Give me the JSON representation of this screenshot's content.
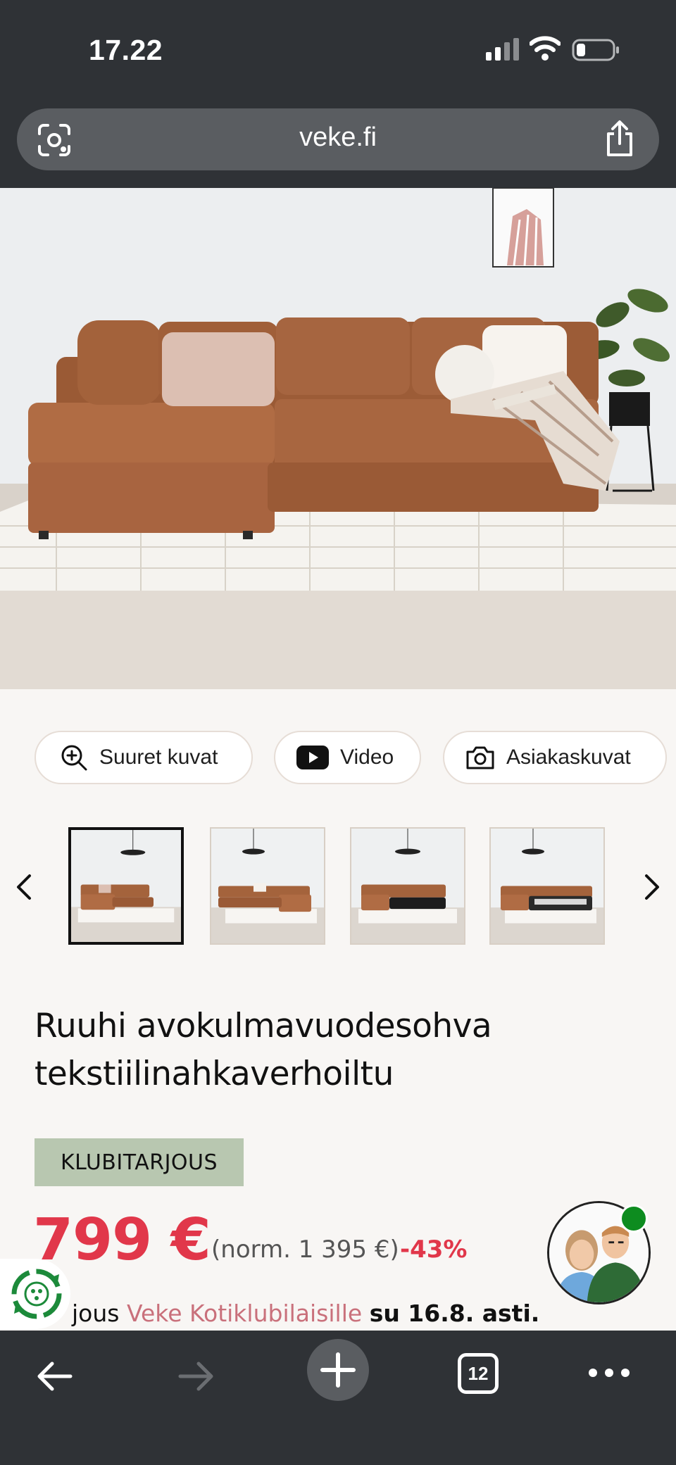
{
  "status_bar": {
    "time": "17.22"
  },
  "browser": {
    "url": "veke.fi",
    "tab_count": "12"
  },
  "media_buttons": {
    "large_images": "Suuret kuvat",
    "video": "Video",
    "customer_photos": "Asiakaskuvat"
  },
  "thumbnails": {
    "count": 4,
    "active_index": 0
  },
  "product": {
    "title_line1": "Ruuhi avokulmavuodesohva",
    "title_line2": "tekstiilinahkaverhoiltu",
    "badge": "KLUBITARJOUS",
    "price": "799 €",
    "normal_price": "(norm. 1 395 €)",
    "discount": "-43%",
    "offer_prefix": "jous",
    "offer_link": "Veke Kotiklubilaisille",
    "offer_suffix": "su 16.8. asti."
  },
  "colors": {
    "sale_red": "#e1374a",
    "badge_green": "#b8c7b0",
    "link_pink": "#c9707b",
    "chrome_dark": "#2f3236"
  },
  "icons": [
    "lens-icon",
    "share-icon",
    "zoom-icon",
    "video-icon",
    "camera-icon",
    "chevron-left-icon",
    "chevron-right-icon",
    "recycle-icon",
    "back-icon",
    "forward-icon",
    "plus-icon",
    "tabs-icon",
    "more-icon"
  ]
}
